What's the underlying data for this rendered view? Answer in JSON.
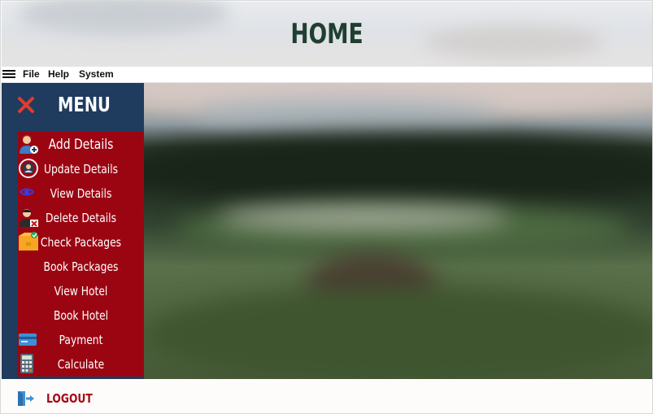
{
  "window": {
    "title": "HOME"
  },
  "menubar": {
    "items": [
      "File",
      "Help",
      "System"
    ]
  },
  "sidebar": {
    "title": "MENU",
    "items": [
      {
        "label": "Add Details",
        "icon": "add-user-icon"
      },
      {
        "label": "Update Details",
        "icon": "update-user-icon"
      },
      {
        "label": "View Details",
        "icon": "eye-icon"
      },
      {
        "label": "Delete Details",
        "icon": "delete-user-icon"
      },
      {
        "label": "Check Packages",
        "icon": "package-check-icon"
      },
      {
        "label": "Book Packages",
        "icon": ""
      },
      {
        "label": "View Hotel",
        "icon": ""
      },
      {
        "label": "Book Hotel",
        "icon": ""
      },
      {
        "label": "Payment",
        "icon": "credit-card-icon"
      },
      {
        "label": "Calculate",
        "icon": "calculator-icon"
      }
    ],
    "logout": "LOGOUT"
  },
  "colors": {
    "title": "#1f3f31",
    "sidebar_bg": "#1f3b5e",
    "menu_panel": "#9b0512",
    "close_x": "#e23b2e",
    "logout_text": "#a20a15"
  }
}
